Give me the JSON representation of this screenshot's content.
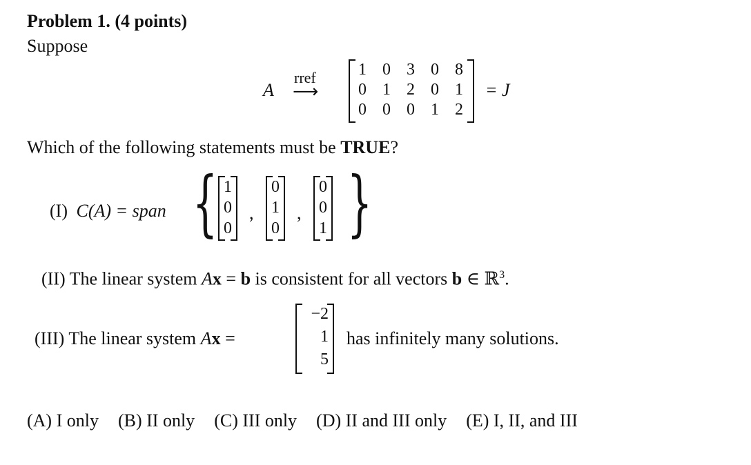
{
  "problem": {
    "heading": "Problem 1.",
    "points": "(4 points)",
    "intro": "Suppose"
  },
  "rref_statement": {
    "lhs": "A",
    "arrow_label": "rref",
    "arrow": "⟶",
    "matrix": [
      [
        "1",
        "0",
        "3",
        "0",
        "8"
      ],
      [
        "0",
        "1",
        "2",
        "0",
        "1"
      ],
      [
        "0",
        "0",
        "0",
        "1",
        "2"
      ]
    ],
    "rhs": "= J"
  },
  "question": {
    "prefix": "Which of the following statements must be ",
    "emphasis": "TRUE",
    "suffix": "?"
  },
  "statements": {
    "I": {
      "label": "(I)",
      "lhs": "C(A) = span",
      "vectors": [
        [
          "1",
          "0",
          "0"
        ],
        [
          "0",
          "1",
          "0"
        ],
        [
          "0",
          "0",
          "1"
        ]
      ],
      "separator": ","
    },
    "II": {
      "label": "(II)",
      "text_1": "The linear system ",
      "Ax": "A",
      "x": "x",
      "eq_b": " = ",
      "b": "b",
      "text_2": " is consistent for all vectors ",
      "b2": "b",
      "in": " ∈ ℝ",
      "sup": "3",
      "end": "."
    },
    "III": {
      "label": "(III)",
      "text_1": "The linear system ",
      "A": "A",
      "x": "x",
      "eq": " =",
      "vector": [
        "−2",
        "1",
        "5"
      ],
      "text_2": "has infinitely many solutions."
    }
  },
  "choices": [
    "(A) I only",
    "(B) II only",
    "(C) III only",
    "(D) II and III only",
    "(E) I, II, and III"
  ]
}
